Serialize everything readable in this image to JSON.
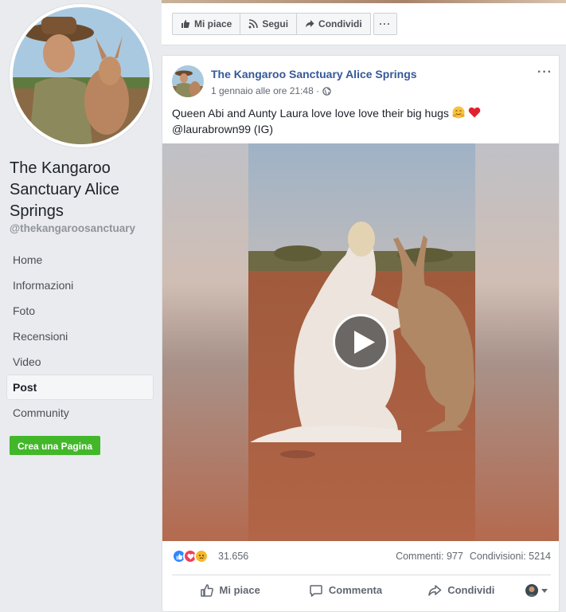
{
  "sidebar": {
    "page_name": "The Kangaroo Sanctuary Alice Springs",
    "handle": "@thekangaroosanctuary",
    "nav": [
      {
        "label": "Home",
        "active": false
      },
      {
        "label": "Informazioni",
        "active": false
      },
      {
        "label": "Foto",
        "active": false
      },
      {
        "label": "Recensioni",
        "active": false
      },
      {
        "label": "Video",
        "active": false
      },
      {
        "label": "Post",
        "active": true
      },
      {
        "label": "Community",
        "active": false
      }
    ],
    "create_page_label": "Crea una Pagina"
  },
  "toolbar": {
    "like_label": "Mi piace",
    "follow_label": "Segui",
    "share_label": "Condividi",
    "more_label": "···"
  },
  "post": {
    "author": "The Kangaroo Sanctuary Alice Springs",
    "timestamp": "1 gennaio alle ore 21:48 ·",
    "menu_label": "···",
    "text_line1": "Queen Abi and Aunty Laura love love love their big hugs",
    "text_line2": "@laurabrown99 (IG)",
    "reaction_count": "31.656",
    "comments": "Commenti: 977",
    "shares": "Condivisioni: 5214",
    "actions": {
      "like": "Mi piace",
      "comment": "Commenta",
      "share": "Condividi"
    }
  },
  "colors": {
    "link": "#365899",
    "create_button": "#42b72a",
    "background": "#e9ebee"
  }
}
